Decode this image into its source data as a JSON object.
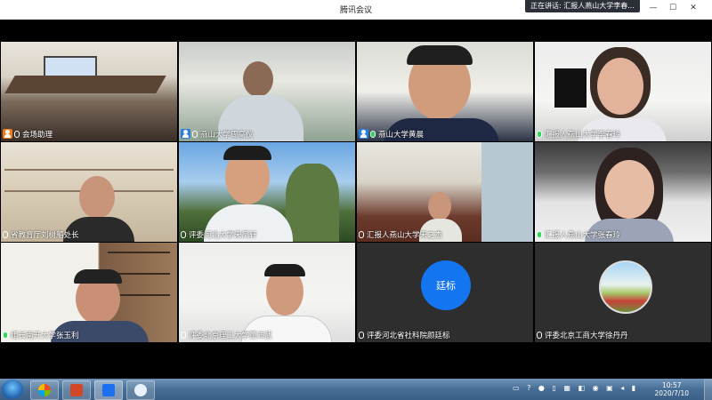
{
  "window": {
    "title": "腾讯会议",
    "speaking_indicator": "正在讲话: 汇报人燕山大学李春...",
    "controls": [
      "—",
      "▢",
      "☐",
      "✕"
    ]
  },
  "participants": [
    {
      "name": "会场助理",
      "badge": "host",
      "mic": "off",
      "kind": "video"
    },
    {
      "name": "燕山大学周高仪",
      "badge": "user",
      "mic": "off",
      "kind": "video"
    },
    {
      "name": "燕山大学黄晨",
      "badge": "user",
      "mic": "on",
      "kind": "video"
    },
    {
      "name": "汇报人燕山大学李春玲",
      "badge": "none",
      "mic": "on",
      "kind": "video"
    },
    {
      "name": "省教育厅刘树船处长",
      "badge": "none",
      "mic": "off",
      "kind": "video"
    },
    {
      "name": "评委河北大学宋凤轩",
      "badge": "none",
      "mic": "off",
      "kind": "video"
    },
    {
      "name": "汇报人燕山大学宋之杰",
      "badge": "none",
      "mic": "off",
      "kind": "video"
    },
    {
      "name": "汇报人燕山大学张春玲",
      "badge": "none",
      "mic": "on",
      "kind": "video"
    },
    {
      "name": "组长南开大学张玉利",
      "badge": "none",
      "mic": "on",
      "kind": "video"
    },
    {
      "name": "评委北京理工大学董沛武",
      "badge": "none",
      "mic": "off",
      "kind": "video"
    },
    {
      "name": "评委河北省社科院颜廷标",
      "badge": "none",
      "mic": "off",
      "kind": "avatar",
      "avatar_text": "廷标"
    },
    {
      "name": "评委北京工商大学徐丹丹",
      "badge": "none",
      "mic": "off",
      "kind": "avatar-photo"
    }
  ],
  "taskbar": {
    "apps": [
      "start-icon",
      "media-icon",
      "powerpoint-icon",
      "tencent-meeting-icon",
      "cloud-icon"
    ],
    "time": "10:57",
    "date": "2020/7/10"
  }
}
